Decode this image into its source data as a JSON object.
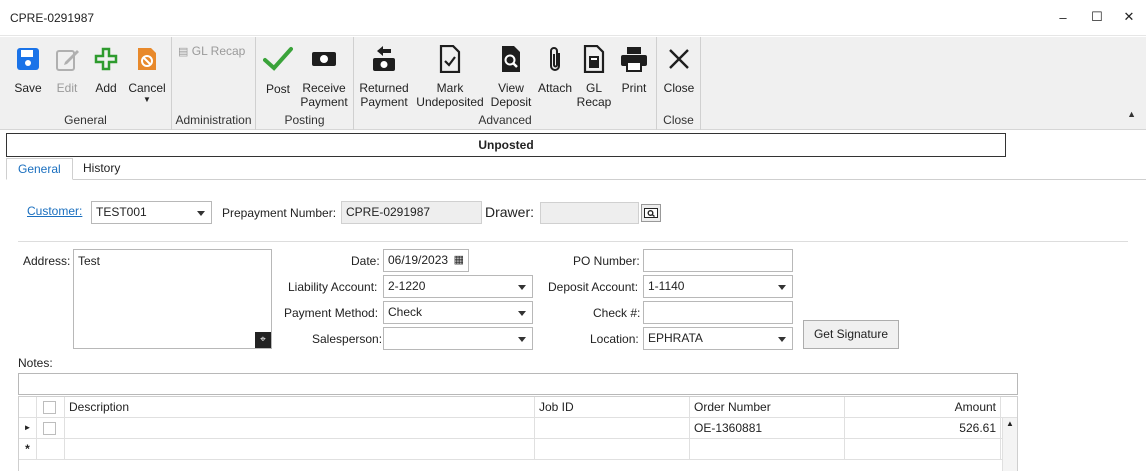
{
  "window": {
    "title": "CPRE-0291987",
    "minimize": "–",
    "maximize": "☐",
    "close": "✕"
  },
  "ribbon": {
    "groups": {
      "general": "General",
      "administration": "Administration",
      "posting": "Posting",
      "advanced": "Advanced",
      "close": "Close"
    },
    "buttons": {
      "save": "Save",
      "edit": "Edit",
      "add": "Add",
      "cancel": "Cancel",
      "gl_recap_small": "GL Recap",
      "post": "Post",
      "receive_payment_1": "Receive",
      "receive_payment_2": "Payment",
      "returned_payment_1": "Returned",
      "returned_payment_2": "Payment",
      "mark_undeposited_1": "Mark",
      "mark_undeposited_2": "Undeposited",
      "view_deposit_1": "View",
      "view_deposit_2": "Deposit",
      "attach": "Attach",
      "gl_recap_1": "GL",
      "gl_recap_2": "Recap",
      "print": "Print",
      "close": "Close"
    },
    "colors": {
      "save": "#1a73e8",
      "add": "#2e9b2e",
      "cancel": "#e8892b",
      "post": "#3aa33a"
    }
  },
  "status": "Unposted",
  "tabs": [
    "General",
    "History"
  ],
  "form": {
    "customer_label": "Customer:",
    "customer_value": "TEST001",
    "prepayment_label": "Prepayment Number:",
    "prepayment_value": "CPRE-0291987",
    "drawer_label": "Drawer:",
    "drawer_value": "",
    "address_label": "Address:",
    "address_value": "Test",
    "date_label": "Date:",
    "date_value": "06/19/2023",
    "liability_label": "Liability Account:",
    "liability_value": "2-1220",
    "payment_method_label": "Payment Method:",
    "payment_method_value": "Check",
    "salesperson_label": "Salesperson:",
    "salesperson_value": "",
    "po_label": "PO Number:",
    "po_value": "",
    "deposit_label": "Deposit Account:",
    "deposit_value": "1-1140",
    "check_label": "Check #:",
    "check_value": "",
    "location_label": "Location:",
    "location_value": "EPHRATA",
    "signature_button": "Get Signature",
    "notes_label": "Notes:",
    "notes_value": ""
  },
  "grid": {
    "columns": [
      "Description",
      "Job ID",
      "Order Number",
      "Amount"
    ],
    "rows": [
      {
        "description": "",
        "job_id": "",
        "order_number": "OE-1360881",
        "amount": "526.61"
      }
    ],
    "new_row_marker": "*"
  }
}
